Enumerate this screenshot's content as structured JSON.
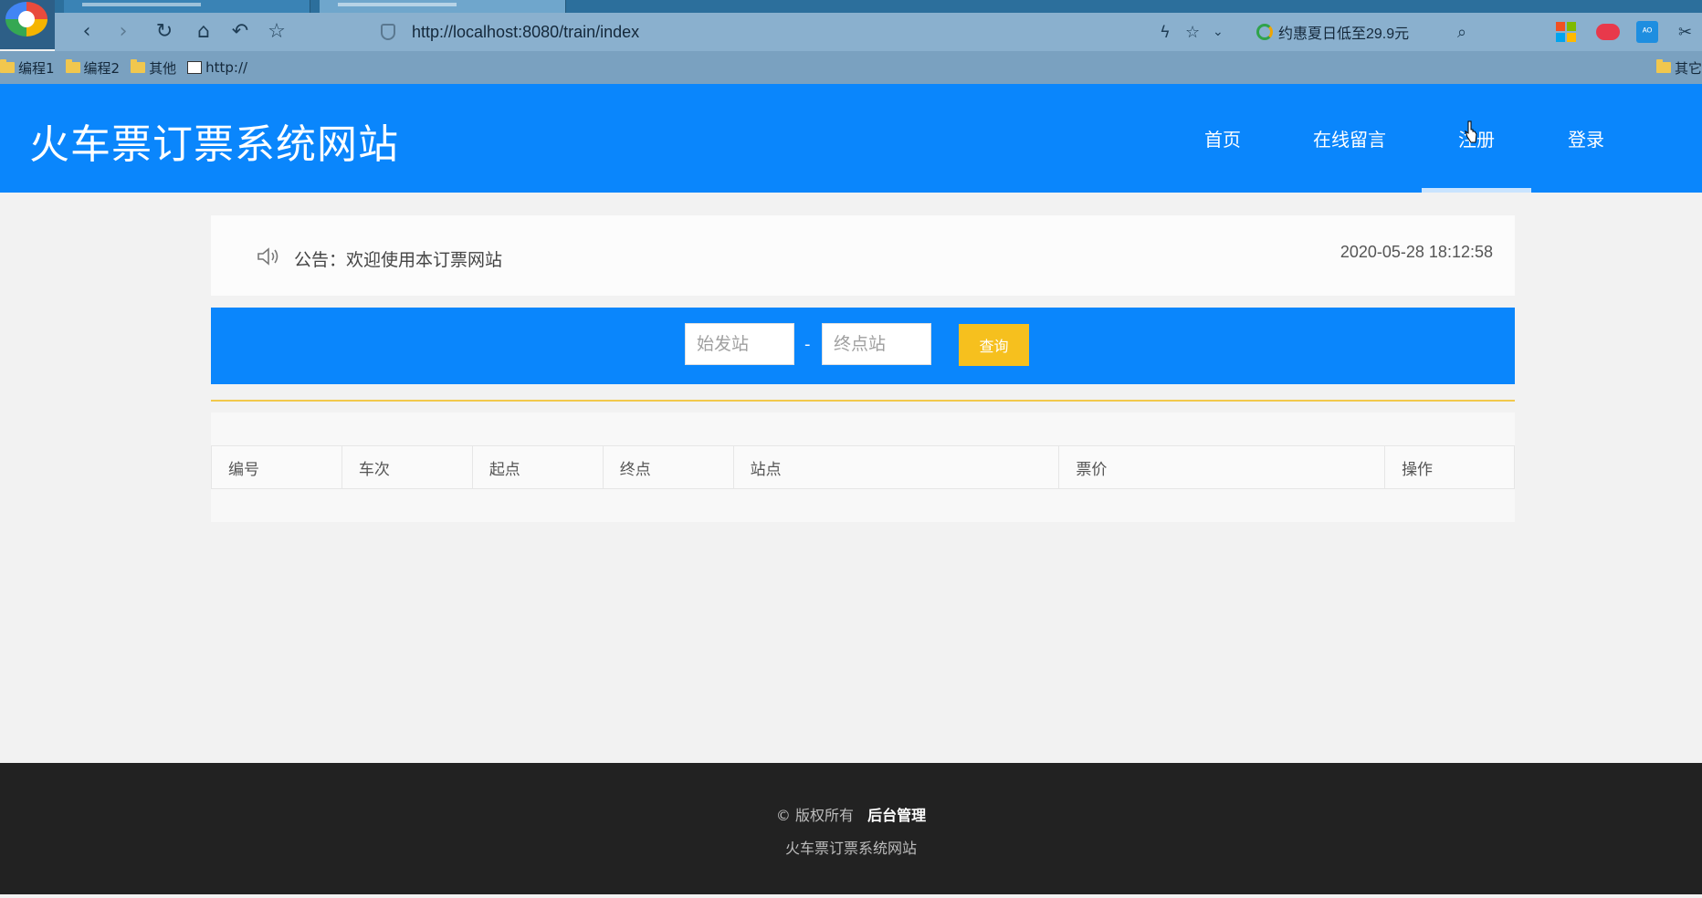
{
  "browser": {
    "url": "http://localhost:8080/train/index",
    "promo_text": "约惠夏日低至29.9元",
    "bookmarks": [
      "编程1",
      "编程2",
      "其他",
      "http://"
    ],
    "bookmark_right": "其它"
  },
  "site": {
    "title": "火车票订票系统网站",
    "nav": [
      "首页",
      "在线留言",
      "注册",
      "登录"
    ],
    "active_nav": "注册"
  },
  "notice": {
    "text": "公告：欢迎使用本订票网站",
    "time": "2020-05-28 18:12:58"
  },
  "search": {
    "from_placeholder": "始发站",
    "separator": "-",
    "to_placeholder": "终点站",
    "button_label": "查询"
  },
  "table": {
    "columns": [
      "编号",
      "车次",
      "起点",
      "终点",
      "站点",
      "票价",
      "操作"
    ],
    "rows": []
  },
  "footer": {
    "copyright": "© 版权所有",
    "admin_link": "后台管理",
    "site_name": "火车票订票系统网站"
  },
  "colors": {
    "brand_blue": "#0a86fc",
    "search_button": "#f6c01e",
    "footer_bg": "#222222"
  }
}
